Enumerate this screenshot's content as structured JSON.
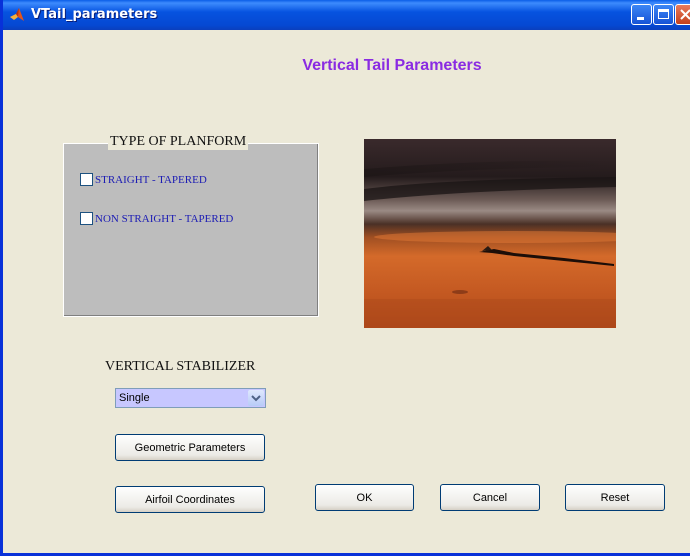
{
  "window": {
    "title": "VTail_parameters"
  },
  "heading": "Vertical Tail Parameters",
  "planform": {
    "title": "TYPE OF PLANFORM",
    "options": [
      {
        "label": "STRAIGHT - TAPERED",
        "checked": false
      },
      {
        "label": "NON STRAIGHT - TAPERED",
        "checked": false
      }
    ]
  },
  "stabilizer": {
    "label": "VERTICAL STABILIZER",
    "selected": "Single"
  },
  "buttons": {
    "geometric": "Geometric Parameters",
    "airfoil": "Airfoil Coordinates",
    "ok": "OK",
    "cancel": "Cancel",
    "reset": "Reset"
  },
  "icons": {
    "app": "matlab-icon",
    "minimize": "minimize-icon",
    "maximize": "maximize-icon",
    "close": "close-icon",
    "dropdown": "chevron-down-icon"
  },
  "colors": {
    "heading": "#8a2be2",
    "option_text": "#1c1cb4",
    "dropdown_bg": "#c7c7ff",
    "panel_bg": "#bdbdbd"
  }
}
